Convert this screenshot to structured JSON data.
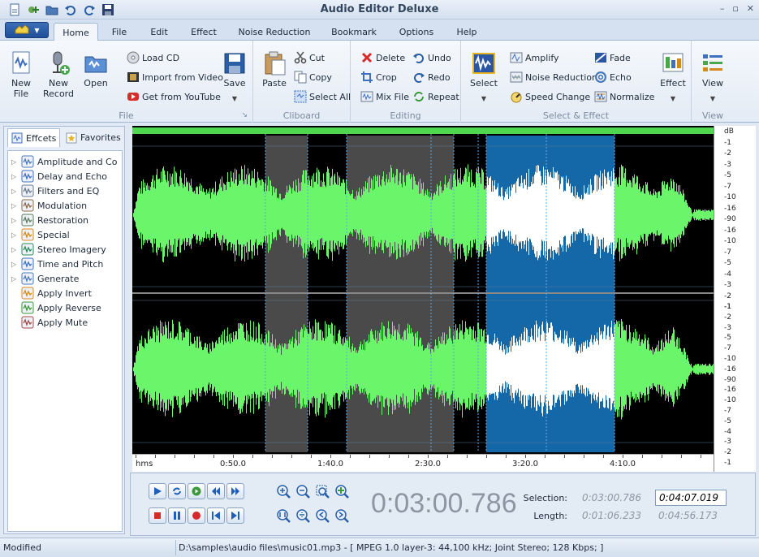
{
  "window": {
    "title": "Audio Editor Deluxe"
  },
  "quick_access": [
    "new-file-icon",
    "add-icon",
    "open-icon",
    "undo-icon",
    "redo-icon",
    "save-icon"
  ],
  "tabs": [
    {
      "label": "Home",
      "active": true
    },
    {
      "label": "File"
    },
    {
      "label": "Edit"
    },
    {
      "label": "Effect"
    },
    {
      "label": "Noise Reduction"
    },
    {
      "label": "Bookmark"
    },
    {
      "label": "Options"
    },
    {
      "label": "Help"
    }
  ],
  "ribbon": {
    "file": {
      "label": "File",
      "new_file": "New\nFile",
      "new_record": "New\nRecord",
      "open": "Open",
      "load_cd": "Load CD",
      "import_video": "Import from Video",
      "youtube": "Get from YouTube",
      "save": "Save"
    },
    "clipboard": {
      "label": "Cliboard",
      "paste": "Paste",
      "cut": "Cut",
      "copy": "Copy",
      "select_all": "Select All"
    },
    "editing": {
      "label": "Editing",
      "delete": "Delete",
      "crop": "Crop",
      "mix_file": "Mix File",
      "undo": "Undo",
      "redo": "Redo",
      "repeat": "Repeat"
    },
    "select_effect": {
      "label": "Select & Effect",
      "select": "Select",
      "amplify": "Amplify",
      "noise_reduction": "Noise Reduction",
      "speed_change": "Speed Change",
      "fade": "Fade",
      "echo": "Echo",
      "normalize": "Normalize",
      "effect": "Effect"
    },
    "view": {
      "label": "View",
      "view": "View"
    }
  },
  "left_panel": {
    "tabs": [
      {
        "label": "Effcets",
        "active": true
      },
      {
        "label": "Favorites"
      }
    ],
    "items": [
      {
        "label": "Amplitude and Co",
        "expandable": true
      },
      {
        "label": "Delay and Echo",
        "expandable": true
      },
      {
        "label": "Filters and EQ",
        "expandable": true
      },
      {
        "label": "Modulation",
        "expandable": true
      },
      {
        "label": "Restoration",
        "expandable": true
      },
      {
        "label": "Special",
        "expandable": true
      },
      {
        "label": "Stereo Imagery",
        "expandable": true
      },
      {
        "label": "Time and Pitch",
        "expandable": true
      },
      {
        "label": "Generate",
        "expandable": true
      },
      {
        "label": "Apply Invert",
        "expandable": false
      },
      {
        "label": "Apply Reverse",
        "expandable": false
      },
      {
        "label": "Apply Mute",
        "expandable": false
      }
    ]
  },
  "waveform": {
    "ruler": [
      "hms",
      "0:50.0",
      "1:40.0",
      "2:30.0",
      "3:20.0",
      "4:10.0"
    ],
    "db_labels": [
      "dB",
      "-1",
      "-2",
      "-3",
      "-5",
      "-7",
      "-10",
      "-16",
      "-90",
      "-16",
      "-10",
      "-7",
      "-5",
      "-4",
      "-3",
      "-2",
      "-1"
    ],
    "colors": {
      "wave": "#6bf56b",
      "selected_wave": "#ffffff",
      "selection": "#1568a8",
      "highlight": "#4a4a4a",
      "background": "#000000"
    }
  },
  "transport": {
    "current_time": "0:03:00.786",
    "selection_label": "Selection:",
    "length_label": "Length:",
    "selection_start": "0:03:00.786",
    "selection_end": "0:04:07.019",
    "length_sel": "0:01:06.233",
    "length_total": "0:04:56.173"
  },
  "status": {
    "state": "Modified",
    "file_info": "D:\\samples\\audio files\\music01.mp3 - [ MPEG 1.0 layer-3: 44,100 kHz; Joint Stereo; 128 Kbps; ]"
  }
}
